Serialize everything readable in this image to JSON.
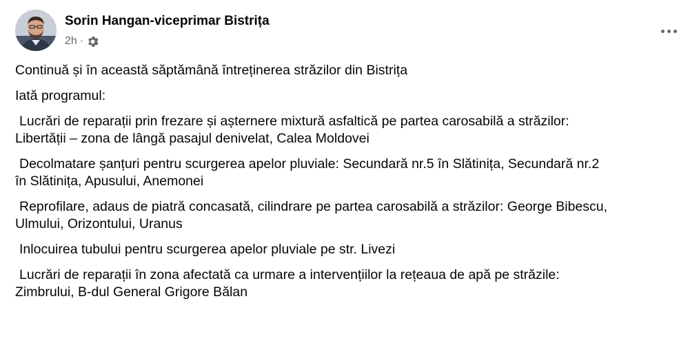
{
  "post": {
    "author": "Sorin Hangan-viceprimar Bistrița",
    "time": "2h",
    "separator": "·",
    "privacy_icon": "gear-icon",
    "more_icon": "more-options-icon",
    "avatar": "profile-photo",
    "paragraphs": {
      "intro": "Continuă și în această săptămână întreținerea străzilor din Bistrița",
      "program": "Iată programul:",
      "item1_l1": "Lucrări de reparații prin frezare și așternere mixtură asfaltică pe partea carosabilă a străzilor:",
      "item1_l2": "Libertății – zona de lângă pasajul denivelat, Calea Moldovei",
      "item2_l1": "Decolmatare șanțuri pentru scurgerea apelor pluviale: Secundară nr.5 în Slătinița, Secundară nr.2",
      "item2_l2": "în Slătinița, Apusului, Anemonei",
      "item3_l1": "Reprofilare, adaus de piatră concasată, cilindrare pe partea carosabilă a străzilor: George Bibescu,",
      "item3_l2": "Ulmului, Orizontului, Uranus",
      "item4_l1": "Inlocuirea tubului pentru scurgerea apelor pluviale pe str. Livezi",
      "item5_l1": "Lucrări de reparații în zona afectată ca urmare a intervențiilor la rețeaua de apă pe străzile:",
      "item5_l2": "Zimbrului, B-dul General Grigore Bălan"
    }
  }
}
